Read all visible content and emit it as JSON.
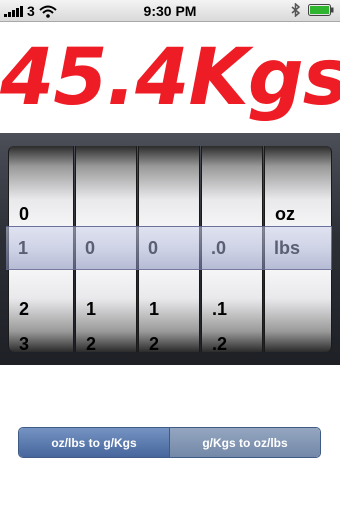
{
  "status_bar": {
    "carrier": "3",
    "time": "9:30 PM"
  },
  "result": "45.4Kgs",
  "picker": {
    "columns": [
      {
        "above": "0",
        "selected": "1",
        "below": [
          "2",
          "3"
        ]
      },
      {
        "above": "",
        "selected": "0",
        "below": [
          "1",
          "2"
        ]
      },
      {
        "above": "",
        "selected": "0",
        "below": [
          "1",
          "2"
        ]
      },
      {
        "above": "",
        "selected": ".0",
        "below": [
          ".1",
          ".2"
        ]
      },
      {
        "above": "oz",
        "selected": "lbs",
        "below": [
          "",
          ""
        ]
      }
    ]
  },
  "segmented_control": {
    "options": [
      "oz/lbs to g/Kgs",
      "g/Kgs to oz/lbs"
    ],
    "selected_index": 0
  }
}
